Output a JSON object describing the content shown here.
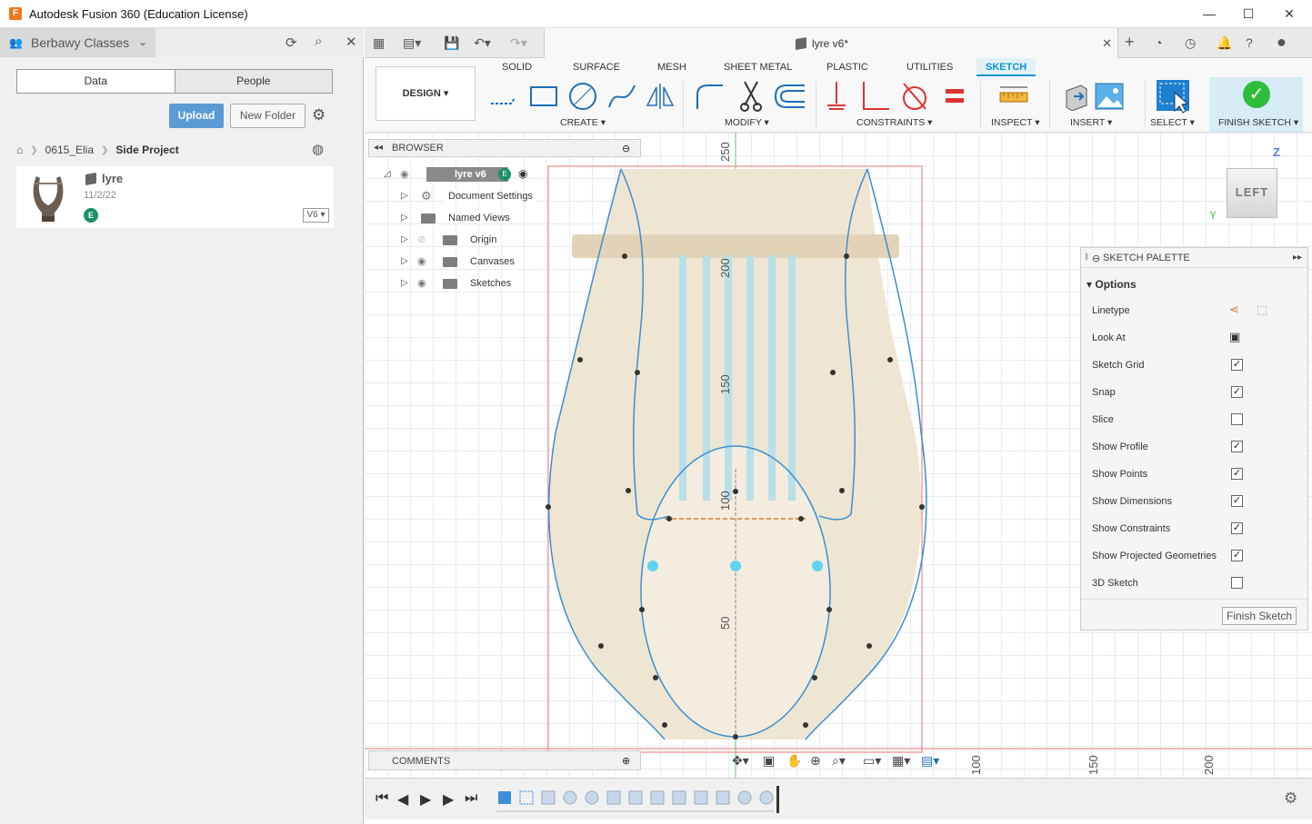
{
  "window": {
    "title": "Autodesk Fusion 360 (Education License)",
    "logo_letter": "F",
    "minimize": "—",
    "maximize": "☐",
    "close": "✕"
  },
  "data_panel": {
    "team_name": "Berbawy Classes",
    "tabs": [
      "Data",
      "People"
    ],
    "upload_label": "Upload",
    "new_folder_label": "New Folder",
    "breadcrumb": [
      "0615_Elia",
      "Side Project"
    ],
    "file": {
      "name": "lyre",
      "date": "11/2/22",
      "badge": "E",
      "version": "V6 ▾"
    }
  },
  "doc_tab": {
    "name": "lyre v6*"
  },
  "ribbon": {
    "workspace": "DESIGN ▾",
    "tabs": [
      "SOLID",
      "SURFACE",
      "MESH",
      "SHEET METAL",
      "PLASTIC",
      "UTILITIES",
      "SKETCH"
    ],
    "active_tab": "SKETCH",
    "groups": [
      "CREATE ▾",
      "MODIFY ▾",
      "CONSTRAINTS ▾",
      "INSPECT ▾",
      "INSERT ▾",
      "SELECT ▾",
      "FINISH SKETCH ▾"
    ]
  },
  "browser": {
    "label": "BROWSER",
    "root": "lyre v6",
    "items": [
      "Document Settings",
      "Named Views",
      "Origin",
      "Canvases",
      "Sketches"
    ]
  },
  "sketch_palette": {
    "title": "SKETCH PALETTE",
    "options_label": "Options",
    "rows": [
      {
        "label": "Linetype",
        "type": "icons"
      },
      {
        "label": "Look At",
        "type": "icon"
      },
      {
        "label": "Sketch Grid",
        "checked": true
      },
      {
        "label": "Snap",
        "checked": true
      },
      {
        "label": "Slice",
        "checked": false
      },
      {
        "label": "Show Profile",
        "checked": true
      },
      {
        "label": "Show Points",
        "checked": true
      },
      {
        "label": "Show Dimensions",
        "checked": true
      },
      {
        "label": "Show Constraints",
        "checked": true
      },
      {
        "label": "Show Projected Geometries",
        "checked": true
      },
      {
        "label": "3D Sketch",
        "checked": false
      }
    ],
    "finish_button": "Finish Sketch"
  },
  "comments_label": "COMMENTS",
  "viewcube": {
    "face": "LEFT",
    "z_axis": "Z",
    "y_axis": "Y"
  },
  "ruler": {
    "vertical": [
      "250",
      "200",
      "150",
      "100",
      "50"
    ],
    "horizontal": [
      "100",
      "150",
      "200"
    ]
  },
  "colors": {
    "accent": "#0696d7",
    "upload": "#5b9bd5",
    "finish": "#2ebd3a",
    "sketch_line": "#3a8fd0",
    "frame_line": "#e57373"
  }
}
